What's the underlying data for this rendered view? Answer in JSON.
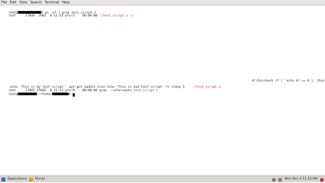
{
  "menu": {
    "items": [
      "File",
      "Edit",
      "View",
      "Search",
      "Terminal",
      "Help"
    ]
  },
  "terminal": {
    "line1_prefix": "root@",
    "line1_cmd": "# ps -ef | grep test_script.x",
    "line2_a": "root     17848  2901  0 11:53 pts/3    00:00:00 ",
    "line2_red": "./test_script.x -c",
    "right_fragment": "#!/bin/bash if [ `echo $? == 0 ]; then",
    "line3_a": " echo 'This is my test script'  apt-get update else echo 'This is end test script' fi sleep 5    ",
    "line3_red": "./test_script.x",
    "line4_a": "root     17865 15802  0 11:53 pts/0    00:00:00 grep --color=auto ",
    "line4_red": "test_script.x",
    "line5_prefix": "root@",
    "line5_mid": ":~/home/",
    "line5_suffix": "# "
  },
  "taskbar": {
    "applications": "Applications",
    "places": "Places",
    "clock": "Mon Dec 4 11:53 AM"
  },
  "colors": {
    "accent_red": "#c81e1e",
    "apps_icon": "#3c6eb4",
    "places_icon": "#e0a030"
  }
}
